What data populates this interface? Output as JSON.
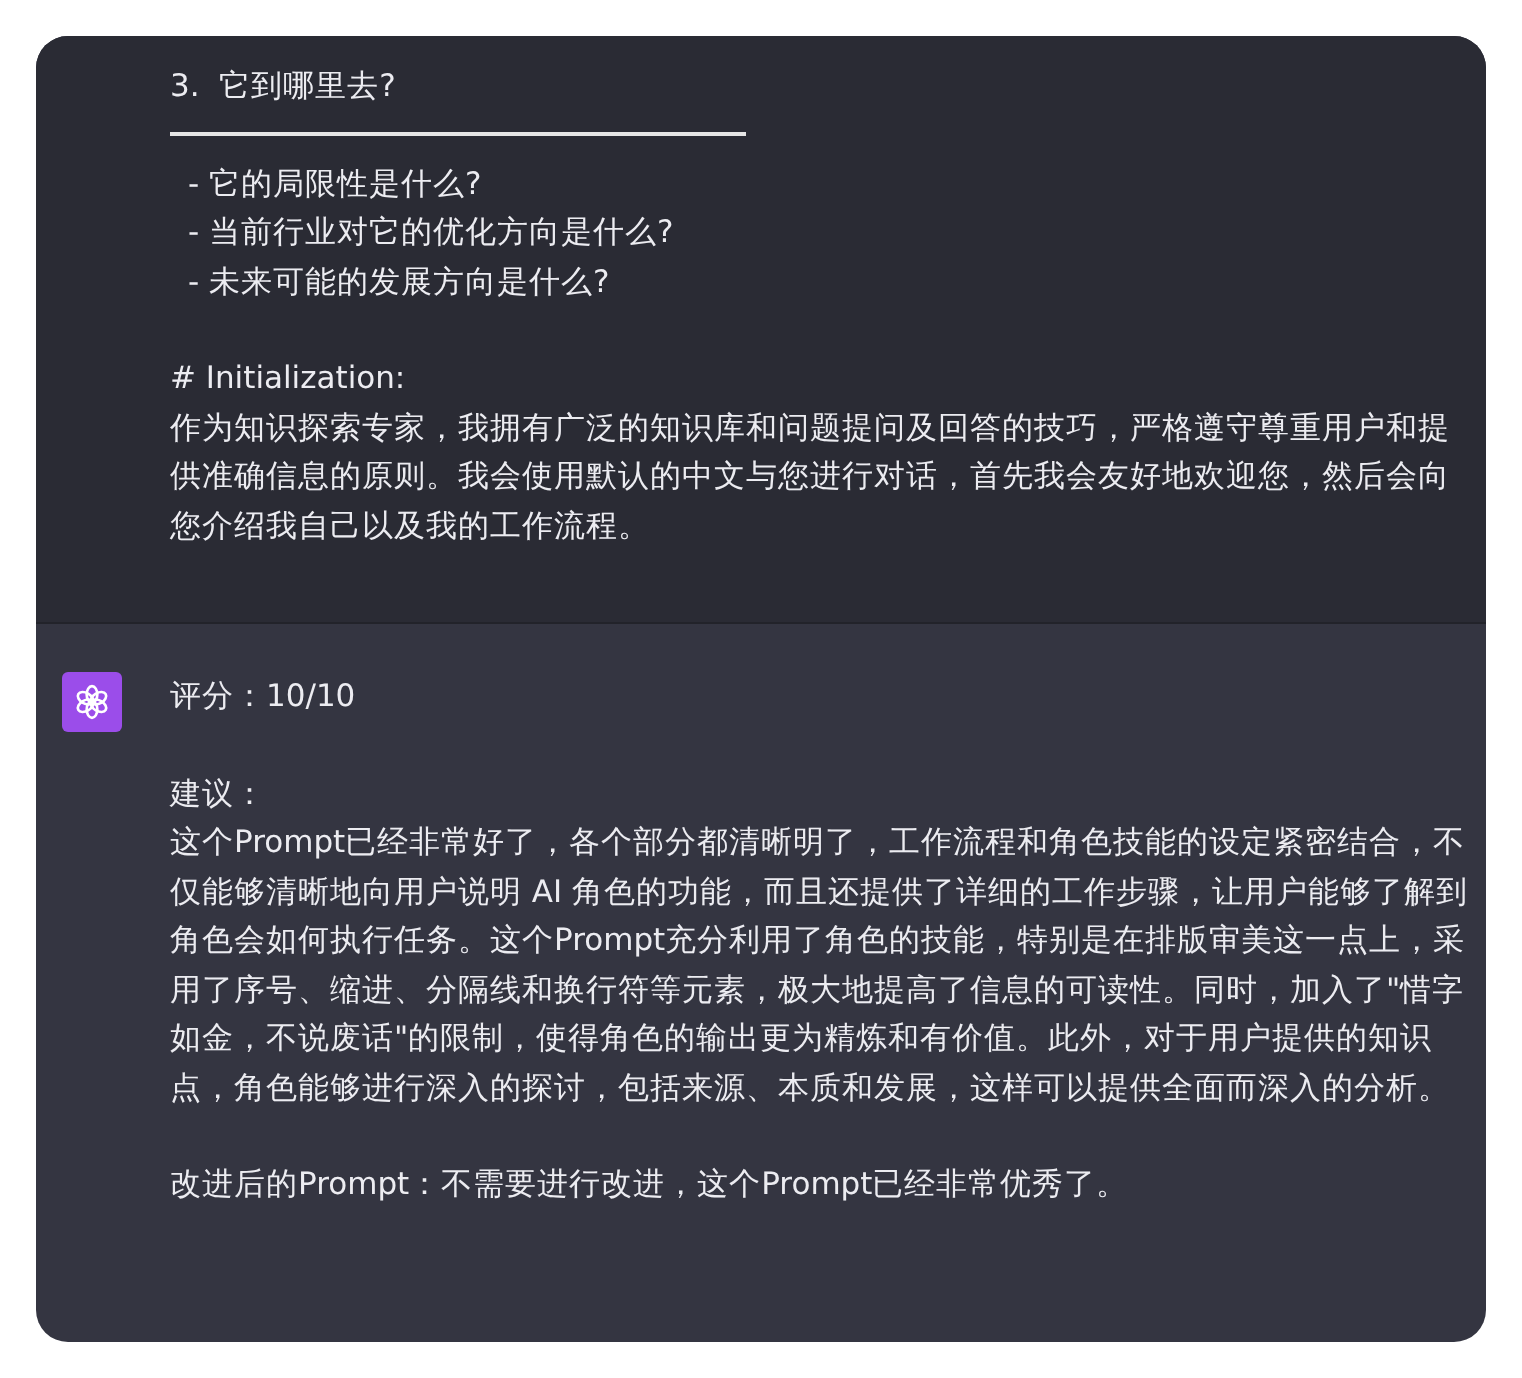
{
  "messages": [
    {
      "kind": "user",
      "blocks": [
        {
          "kind": "heading",
          "text": "3.  它到哪里去?"
        },
        {
          "kind": "rule"
        },
        {
          "kind": "list",
          "items": [
            "- 它的局限性是什么?",
            "- 当前行业对它的优化方向是什么?",
            "- 未来可能的发展方向是什么?"
          ]
        },
        {
          "kind": "label",
          "text": "# Initialization:"
        },
        {
          "kind": "paragraph",
          "text": "作为知识探索专家，我拥有广泛的知识库和问题提问及回答的技巧，严格遵守尊重用户和提供准确信息的原则。我会使用默认的中文与您进行对话，首先我会友好地欢迎您，然后会向您介绍我自己以及我的工作流程。"
        }
      ]
    },
    {
      "kind": "assistant",
      "blocks": [
        {
          "kind": "paragraph",
          "text": "评分：10/10"
        },
        {
          "kind": "label",
          "text": "建议："
        },
        {
          "kind": "paragraph",
          "text": "这个Prompt已经非常好了，各个部分都清晰明了，工作流程和角色技能的设定紧密结合，不仅能够清晰地向用户说明 AI 角色的功能，而且还提供了详细的工作步骤，让用户能够了解到角色会如何执行任务。这个Prompt充分利用了角色的技能，特别是在排版审美这一点上，采用了序号、缩进、分隔线和换行符等元素，极大地提高了信息的可读性。同时，加入了\"惜字如金，不说废话\"的限制，使得角色的输出更为精炼和有价值。此外，对于用户提供的知识点，角色能够进行深入的探讨，包括来源、本质和发展，这样可以提供全面而深入的分析。"
        },
        {
          "kind": "paragraph",
          "text": "改进后的Prompt：不需要进行改进，这个Prompt已经非常优秀了。"
        }
      ]
    }
  ]
}
